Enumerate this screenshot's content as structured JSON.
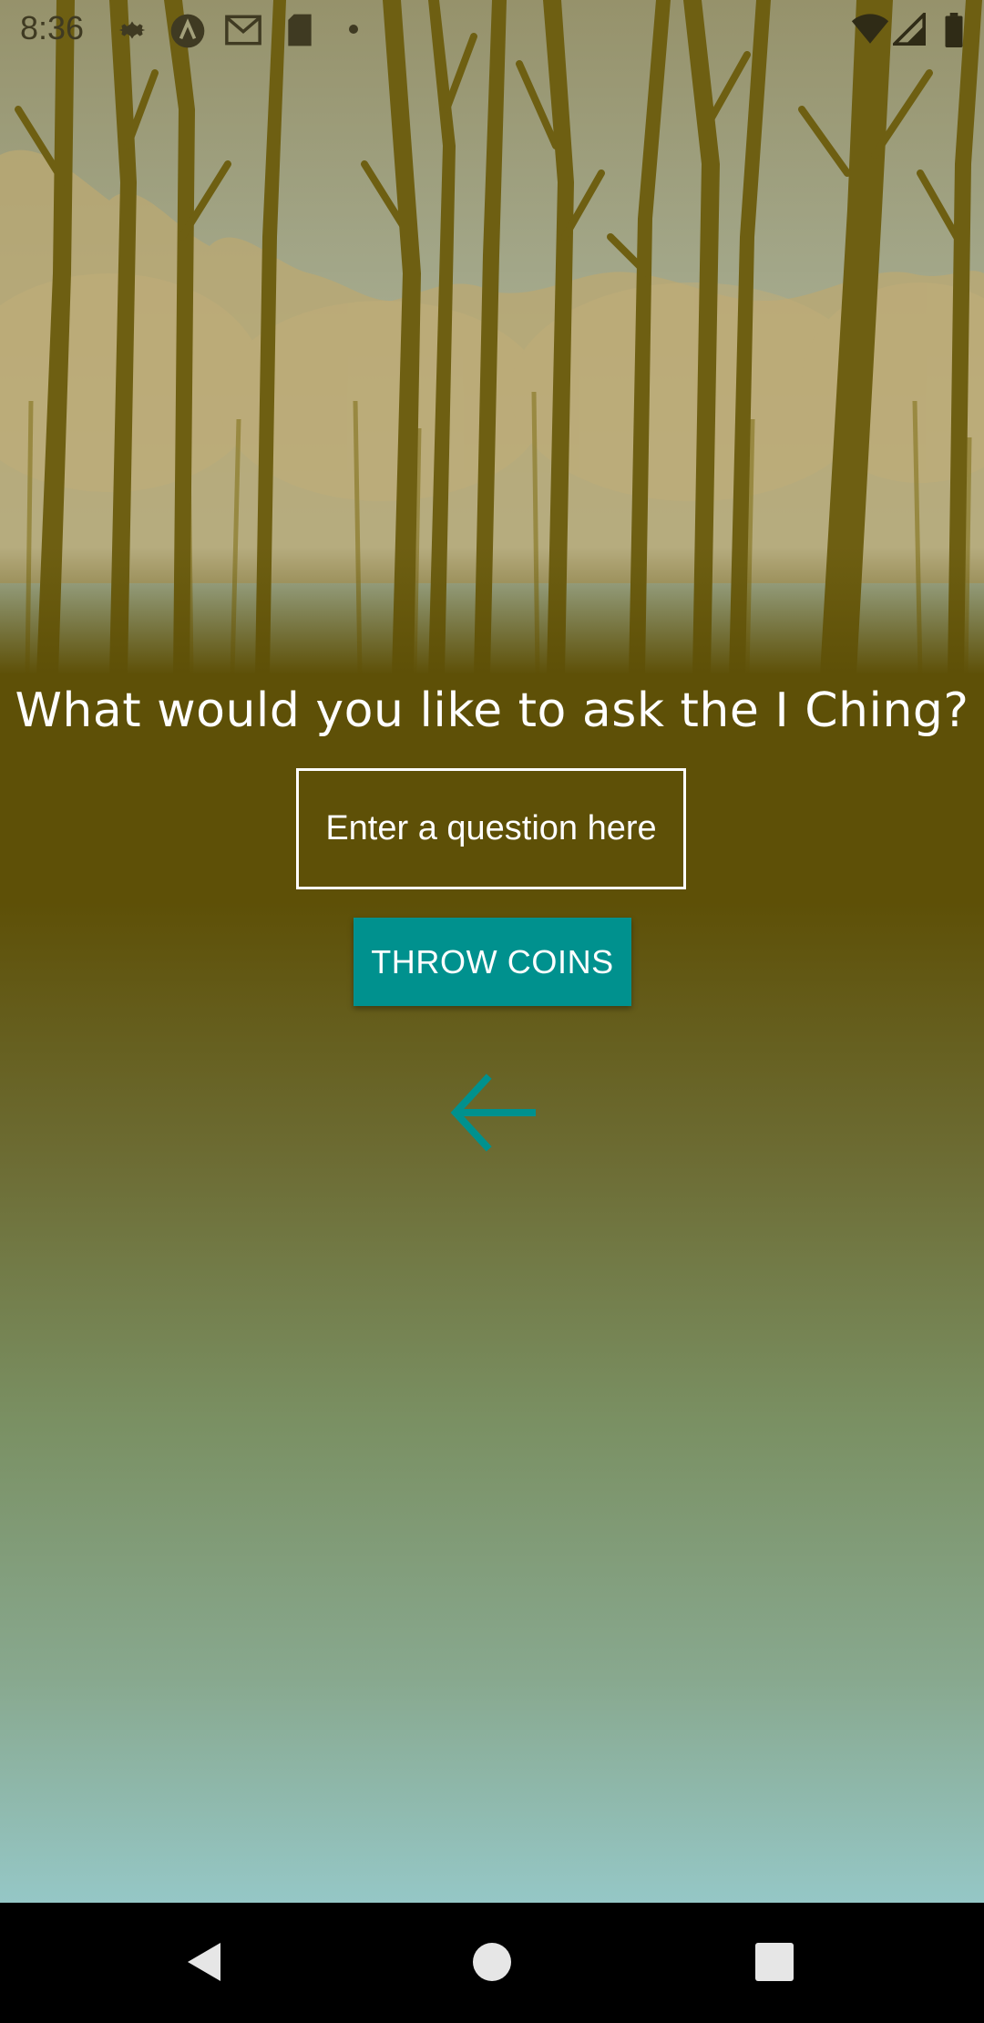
{
  "status_bar": {
    "time": "8:36",
    "icons": [
      "gear-icon",
      "a-badge-icon",
      "gmail-icon",
      "sd-card-icon",
      "dot-icon",
      "wifi-icon",
      "cell-signal-icon",
      "battery-icon"
    ]
  },
  "prompt": {
    "title": "What would you like to ask the I Ching?"
  },
  "question": {
    "placeholder": "Enter a question here",
    "value": ""
  },
  "actions": {
    "throw_label": "THROW COINS",
    "back_icon": "arrow-left-icon"
  },
  "colors": {
    "accent": "#00918e",
    "olive": "#5e5007",
    "sky": "#95c7c6"
  },
  "nav_bar": {
    "icons": [
      "back-triangle-icon",
      "home-circle-icon",
      "recents-square-icon"
    ]
  }
}
